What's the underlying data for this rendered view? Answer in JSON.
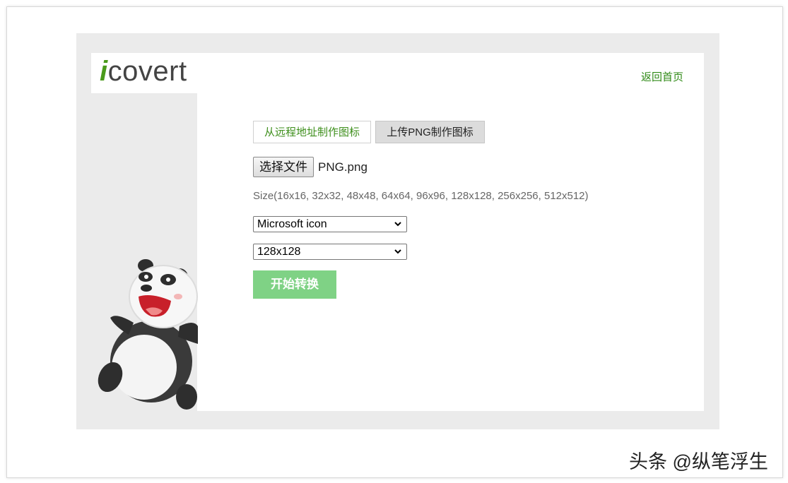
{
  "logo": {
    "i": "i",
    "rest": "covert"
  },
  "header": {
    "home_link": "返回首页"
  },
  "tabs": [
    {
      "label": "从远程地址制作图标",
      "active": false
    },
    {
      "label": "上传PNG制作图标",
      "active": true
    }
  ],
  "file": {
    "button_label": "选择文件",
    "file_name": "PNG.png"
  },
  "size_hint": "Size(16x16, 32x32, 48x48, 64x64, 96x96, 128x128, 256x256, 512x512)",
  "format_select": {
    "selected": "Microsoft icon"
  },
  "size_select": {
    "selected": "128x128"
  },
  "convert_button": {
    "label": "开始转换"
  },
  "watermark": "头条 @纵笔浮生",
  "icons": {
    "chevron": "chevron-down-icon",
    "mascot": "panda-mascot"
  },
  "colors": {
    "accent_green": "#3e8f1c",
    "button_green": "#7fd285",
    "panel_gray": "#ebebeb"
  }
}
